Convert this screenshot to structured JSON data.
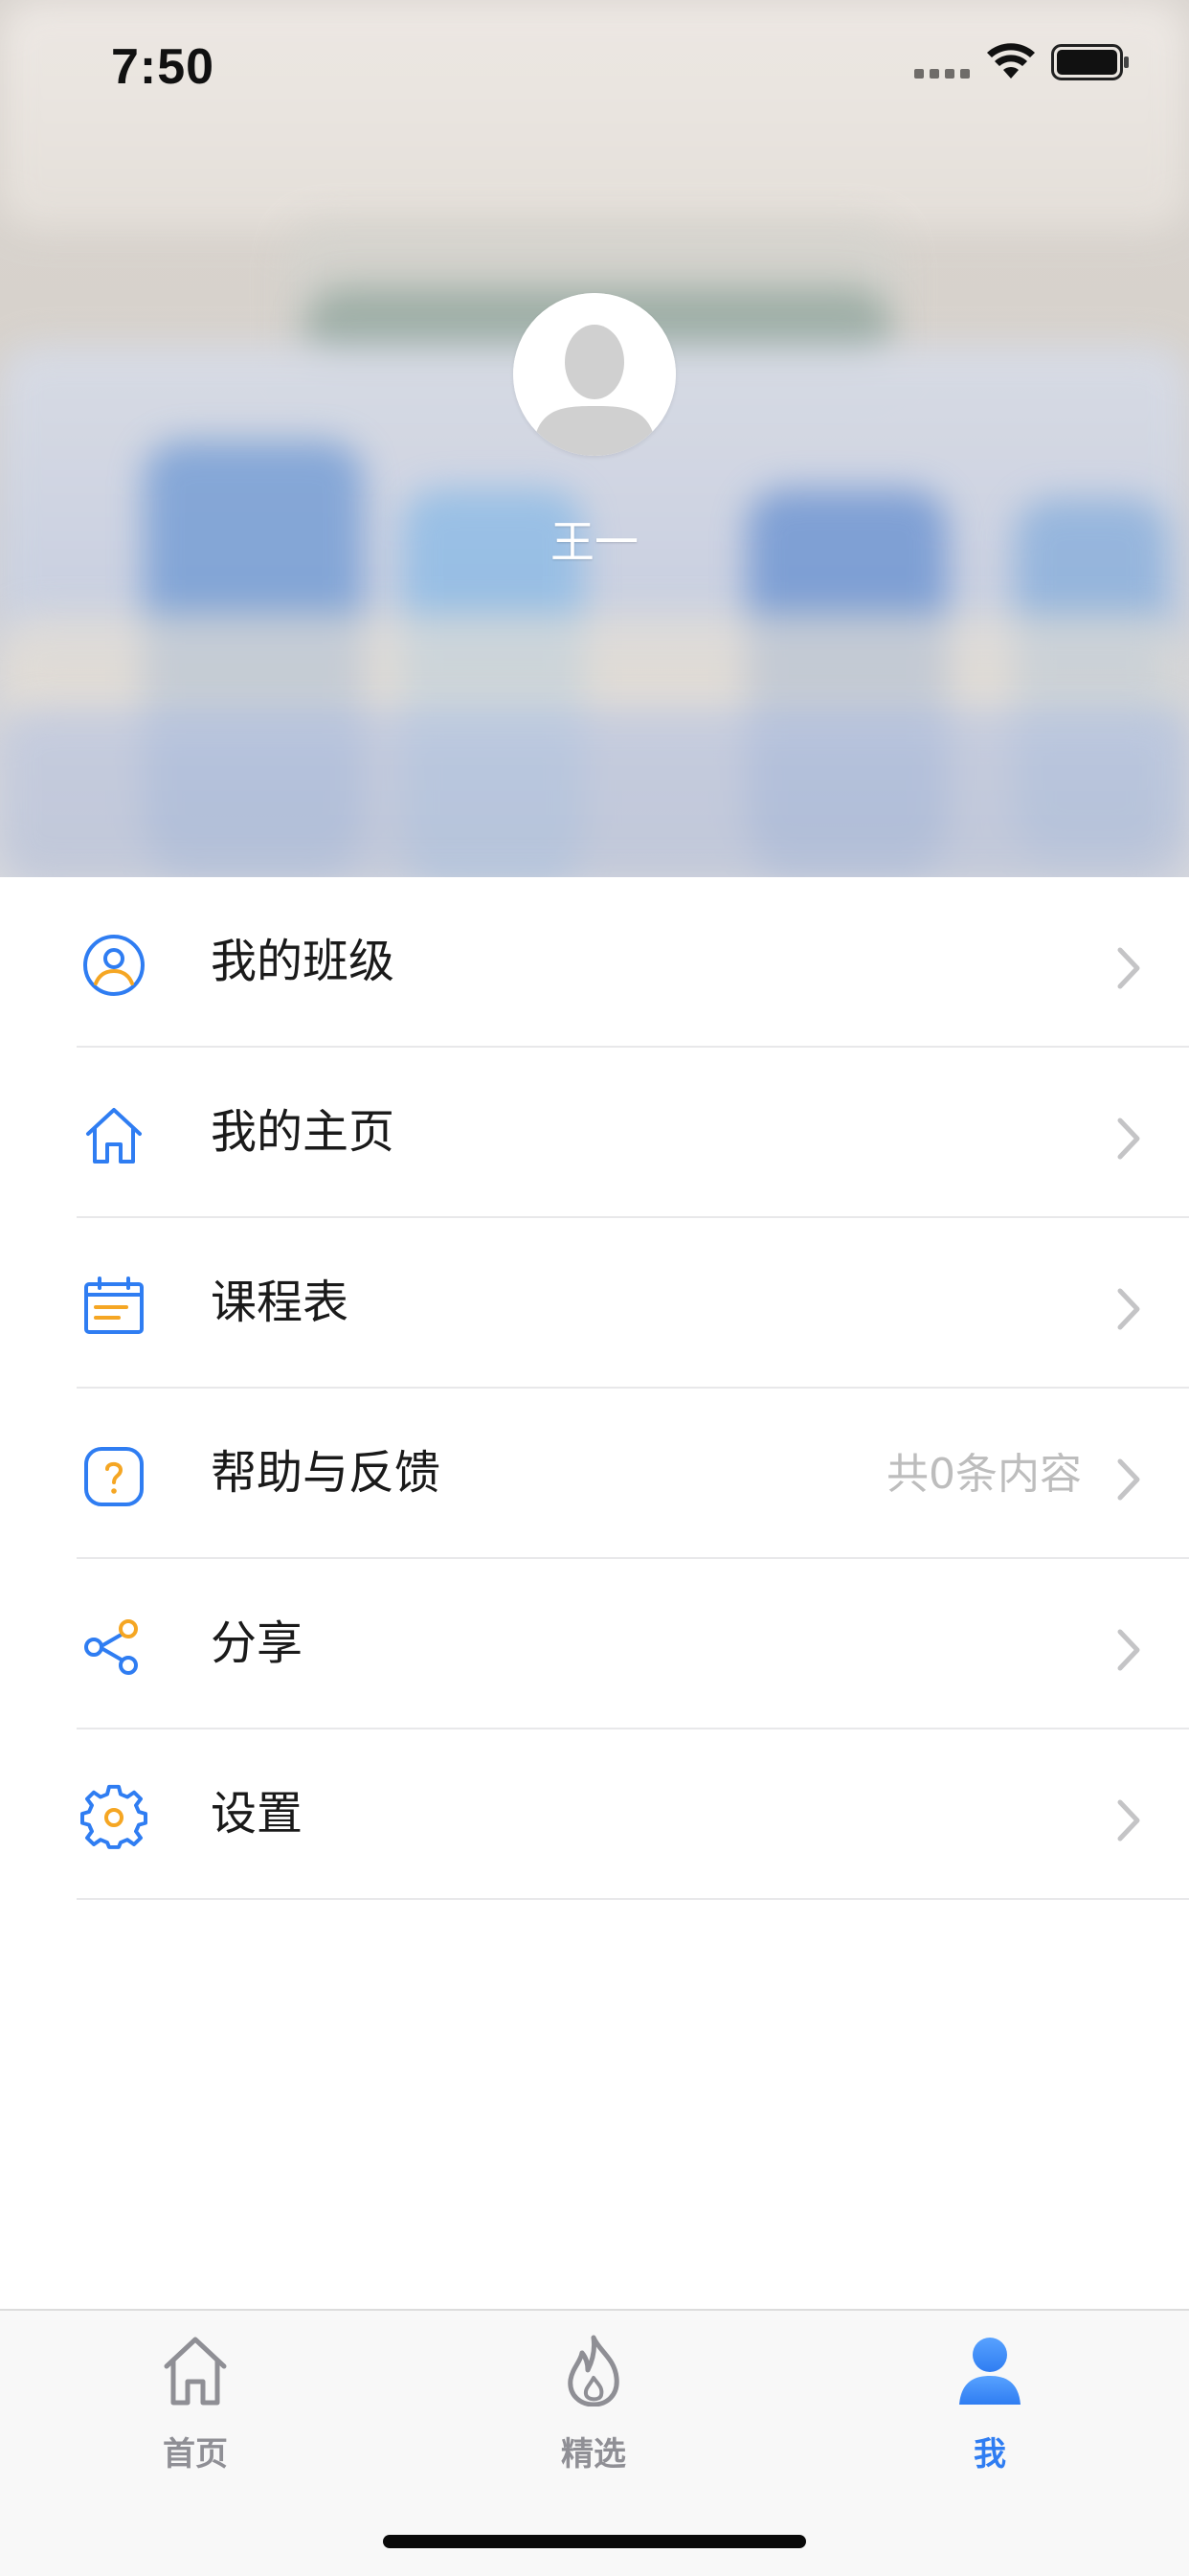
{
  "status_bar": {
    "time": "7:50"
  },
  "profile": {
    "name": "王一"
  },
  "menu": {
    "items": [
      {
        "label": "我的班级",
        "detail": "",
        "icon": "user-circle-icon"
      },
      {
        "label": "我的主页",
        "detail": "",
        "icon": "home-icon"
      },
      {
        "label": "课程表",
        "detail": "",
        "icon": "calendar-icon"
      },
      {
        "label": "帮助与反馈",
        "detail": "共0条内容",
        "icon": "help-icon"
      },
      {
        "label": "分享",
        "detail": "",
        "icon": "share-icon"
      },
      {
        "label": "设置",
        "detail": "",
        "icon": "gear-icon"
      }
    ]
  },
  "tabbar": {
    "tabs": [
      {
        "label": "首页",
        "icon": "home-icon",
        "active": false
      },
      {
        "label": "精选",
        "icon": "flame-icon",
        "active": false
      },
      {
        "label": "我",
        "icon": "person-icon",
        "active": true
      }
    ]
  },
  "colors": {
    "accent_blue": "#2f7df2",
    "accent_orange": "#f5a623",
    "inactive_gray": "#8f8f95"
  }
}
